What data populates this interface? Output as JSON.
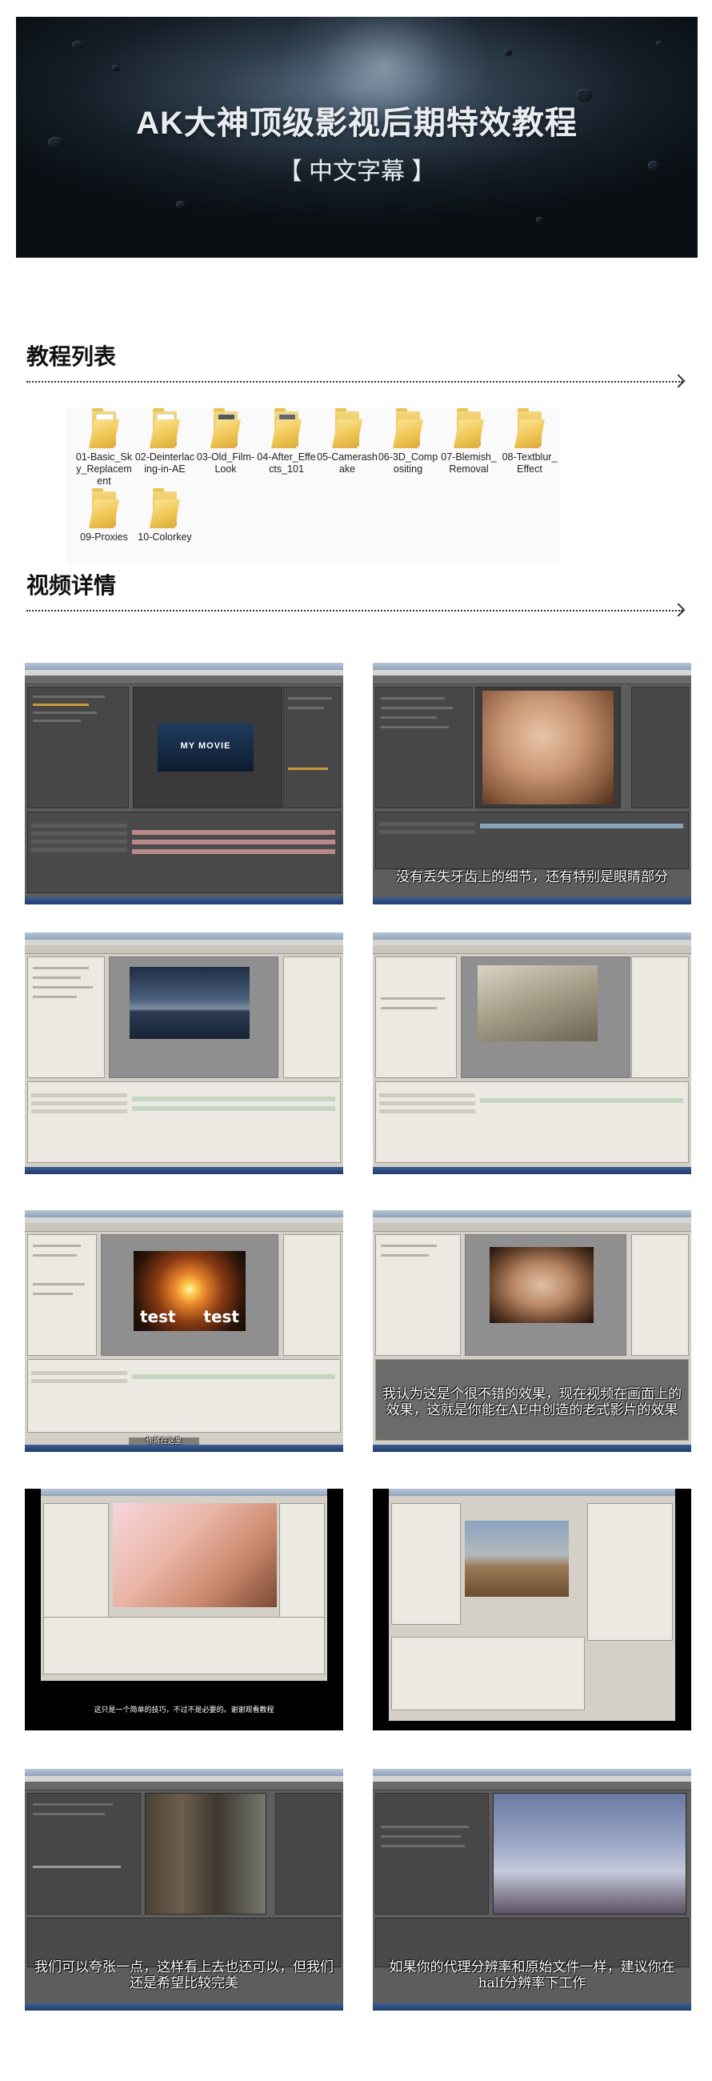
{
  "banner": {
    "title": "AK大神顶级影视后期特效教程",
    "subtitle": "【 中文字幕 】"
  },
  "sections": {
    "list_title": "教程列表",
    "details_title": "视频详情"
  },
  "folders": [
    {
      "name": "01-Basic_Sky_Replacement"
    },
    {
      "name": "02-Deinterlacing-in-AE"
    },
    {
      "name": "03-Old_Film-Look"
    },
    {
      "name": "04-After_Effects_101"
    },
    {
      "name": "05-Camerashake"
    },
    {
      "name": "06-3D_Compositing"
    },
    {
      "name": "07-Blemish_Removal"
    },
    {
      "name": "08-Textblur_Effect"
    },
    {
      "name": "09-Proxies"
    },
    {
      "name": "10-Colorkey"
    }
  ],
  "screenshots": [
    {
      "overlay": "MY MOVIE",
      "subtitle": ""
    },
    {
      "overlay": "",
      "subtitle": "没有丢失牙齿上的细节，还有特别是眼睛部分"
    },
    {
      "overlay": "",
      "subtitle": ""
    },
    {
      "overlay": "",
      "subtitle": ""
    },
    {
      "overlay_left": "test",
      "overlay_right": "test",
      "subtitle": "你将在这里"
    },
    {
      "overlay": "",
      "subtitle": "我认为这是个很不错的效果，现在视频在画面上的效果，这就是你能在AE中创造的老式影片的效果"
    },
    {
      "overlay": "",
      "subtitle": "这只是一个简单的技巧，不过不是必要的。谢谢观看教程"
    },
    {
      "overlay": "",
      "subtitle": ""
    },
    {
      "overlay": "",
      "subtitle": "我们可以夸张一点，这样看上去也还可以，但我们还是希望比较完美"
    },
    {
      "overlay": "",
      "subtitle": "如果你的代理分辨率和原始文件一样，建议你在half分辨率下工作"
    }
  ],
  "colors": {
    "ae_dark": "#5d5d5d",
    "ae_light": "#d4d0c8",
    "folder_yellow": "#efc654",
    "subtitle": "#ffffff"
  }
}
